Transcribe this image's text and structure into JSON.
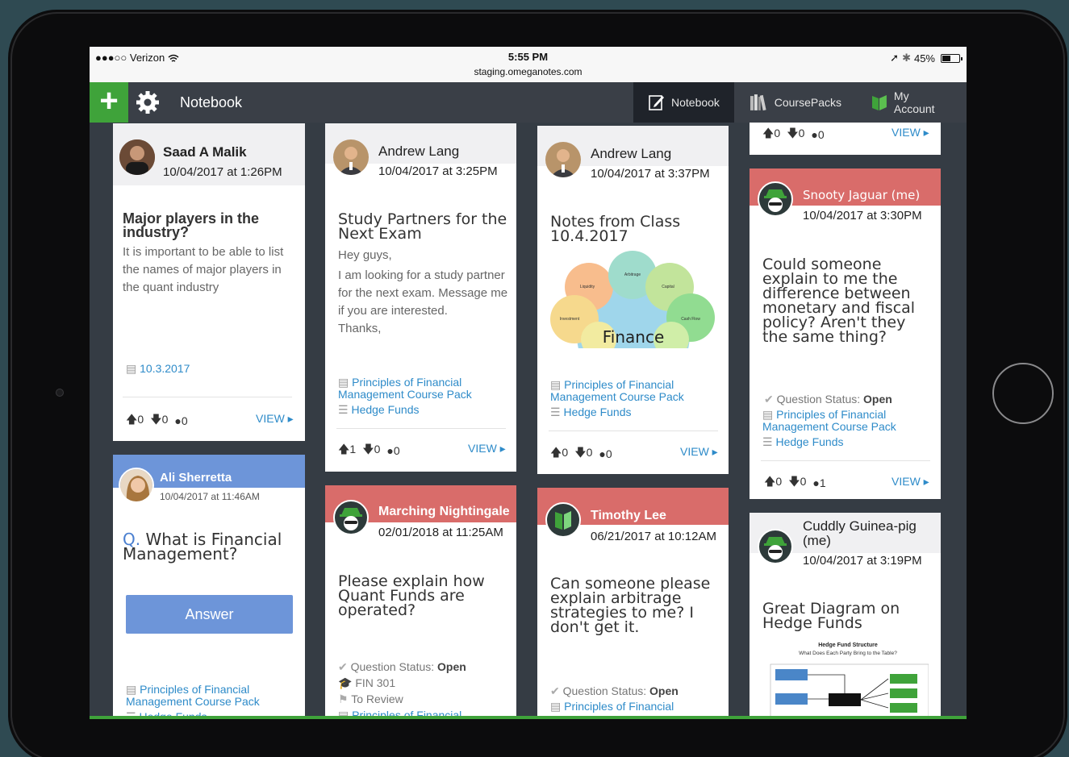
{
  "status": {
    "carrier": "●●●○○ Verizon",
    "time": "5:55 PM",
    "url": "staging.omeganotes.com",
    "battery": "45%"
  },
  "nav": {
    "title": "Notebook",
    "tabs": [
      {
        "label": "Notebook"
      },
      {
        "label": "CoursePacks"
      },
      {
        "label": "My Account"
      }
    ]
  },
  "cards": {
    "c1": {
      "name": "Saad A Malik",
      "date": "10/04/2017 at 1:26PM",
      "title": "Major players in the industry?",
      "body": "It is important to be able to list the names of major players in the quant industry",
      "tag": "10.3.2017",
      "up": "0",
      "down": "0",
      "comments": "0",
      "view": "VIEW ▸"
    },
    "c2": {
      "name": "Ali Sherretta",
      "date": "10/04/2017 at 11:46AM",
      "q": "Q.",
      "title": "What is Financial Management?",
      "answer": "Answer",
      "course": "Principles of Financial Management Course Pack",
      "folder": "Hedge Funds"
    },
    "c3": {
      "name": "Andrew Lang",
      "date": "10/04/2017 at 3:25PM",
      "title": "Study Partners for the Next Exam",
      "body_lines": [
        "Hey guys,",
        "I am looking for a study partner for the next exam. Message me if you are interested.",
        "Thanks,"
      ],
      "course": "Principles of Financial Management Course Pack",
      "folder": "Hedge Funds",
      "up": "1",
      "down": "0",
      "comments": "0",
      "view": "VIEW ▸"
    },
    "c4": {
      "name": "Marching Nightingale",
      "date": "02/01/2018 at 11:25AM",
      "title": "Please explain how Quant Funds are operated?",
      "status_label": "Question Status:",
      "status_value": "Open",
      "class": "FIN 301",
      "flag": "To Review",
      "course": "Principles of Financial"
    },
    "c5": {
      "name": "Andrew Lang",
      "date": "10/04/2017 at 3:37PM",
      "title": "Notes from Class 10.4.2017",
      "diagram_center": "Finance",
      "diagram_labels": [
        "Liquidity",
        "Arbitrage",
        "Capital",
        "Investment",
        "Cash Flow"
      ],
      "course": "Principles of Financial Management Course Pack",
      "folder": "Hedge Funds",
      "up": "0",
      "down": "0",
      "comments": "0",
      "view": "VIEW ▸"
    },
    "c6": {
      "name": "Timothy Lee",
      "date": "06/21/2017 at 10:12AM",
      "title": "Can someone please explain arbitrage strategies to me? I don't get it.",
      "status_label": "Question Status:",
      "status_value": "Open",
      "course": "Principles of Financial"
    },
    "c7": {
      "up": "0",
      "down": "0",
      "comments": "0",
      "view": "VIEW ▸"
    },
    "c8": {
      "name": "Snooty Jaguar (me)",
      "date": "10/04/2017 at 3:30PM",
      "title": "Could someone explain to me the difference between monetary and fiscal policy? Aren't they the same thing?",
      "status_label": "Question Status:",
      "status_value": "Open",
      "course": "Principles of Financial Management Course Pack",
      "folder": "Hedge Funds",
      "up": "0",
      "down": "0",
      "comments": "1",
      "view": "VIEW ▸"
    },
    "c9": {
      "name": "Cuddly Guinea-pig (me)",
      "date": "10/04/2017 at 3:19PM",
      "title": "Great Diagram on Hedge Funds",
      "diagram_title": "Hedge Fund Structure",
      "diagram_subtitle": "What Does Each Party Bring to the Table?"
    }
  },
  "colors": {
    "green": "#3fa33a",
    "link": "#2e8bc9",
    "red_header": "#d96c6a",
    "blue_header": "#6d95d9"
  }
}
